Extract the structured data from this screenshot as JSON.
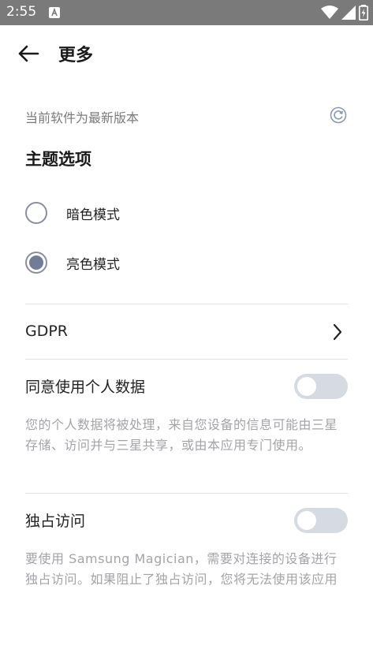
{
  "status_bar": {
    "time": "2:55",
    "icons": [
      "notification-a-icon",
      "wifi-icon",
      "signal-icon",
      "battery-charging-icon"
    ]
  },
  "app_bar": {
    "back_icon": "arrow-left-icon",
    "title": "更多"
  },
  "version": {
    "text": "当前软件为最新版本",
    "icon": "refresh-icon"
  },
  "theme": {
    "title": "主题选项",
    "options": [
      {
        "label": "暗色模式",
        "selected": false
      },
      {
        "label": "亮色模式",
        "selected": true
      }
    ]
  },
  "gdpr": {
    "label": "GDPR",
    "icon": "chevron-right-icon"
  },
  "personal_data": {
    "label": "同意使用个人数据",
    "enabled": false,
    "description": "您的个人数据将被处理，来自您设备的信息可能由三星存储、访问并与三星共享，或由本应用专门使用。"
  },
  "exclusive_access": {
    "label": "独占访问",
    "enabled": false,
    "description": "要使用 Samsung Magician，需要对连接的设备进行独占访问。如果阻止了独占访问，您将无法使用该应用"
  },
  "colors": {
    "status_bar": "#7a7a7a",
    "radio_selected": "#6f7d99",
    "toggle_off": "#d6dae2",
    "secondary_text": "#7a7a7a",
    "description_text": "#a4a4a8"
  }
}
